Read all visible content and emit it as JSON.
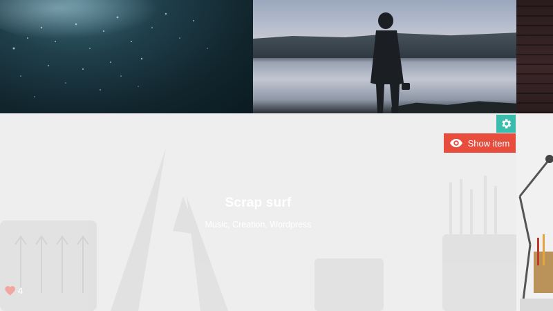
{
  "feature": {
    "title": "Scrap surf",
    "tags": "Music, Creation, Wordpress",
    "show_item_label": "Show item",
    "likes_count": "4"
  },
  "icons": {
    "settings": "gear-icon",
    "show": "eye-icon",
    "likes": "heart-icon"
  },
  "colors": {
    "settings_button": "#3bbdae",
    "show_button": "#e74c3c",
    "overlay": "#eeeeee",
    "heart": "#f2a6a0"
  }
}
